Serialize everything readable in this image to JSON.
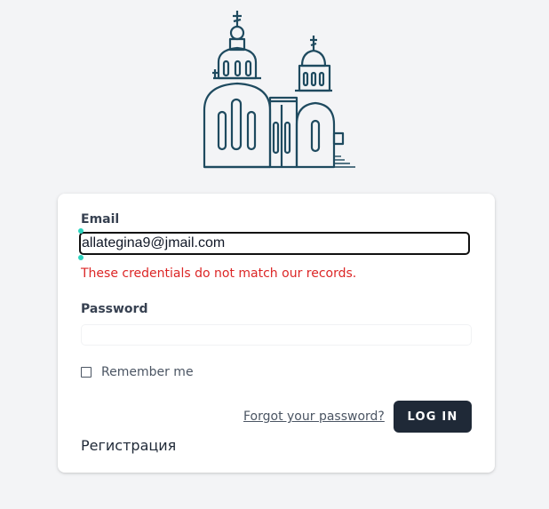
{
  "logo": {
    "icon": "church-icon",
    "color": "#1e4a5f"
  },
  "form": {
    "email_label": "Email",
    "email_value": "allategina9@jmail.com",
    "error_message": "These credentials do not match our records.",
    "password_label": "Password",
    "password_value": "",
    "remember_label": "Remember me",
    "remember_checked": false,
    "forgot_link": "Forgot your password?",
    "login_button": "LOG IN",
    "register_link": "Регистрация"
  },
  "colors": {
    "background": "#f3f4f6",
    "error": "#dc2626",
    "button": "#1f2937"
  }
}
